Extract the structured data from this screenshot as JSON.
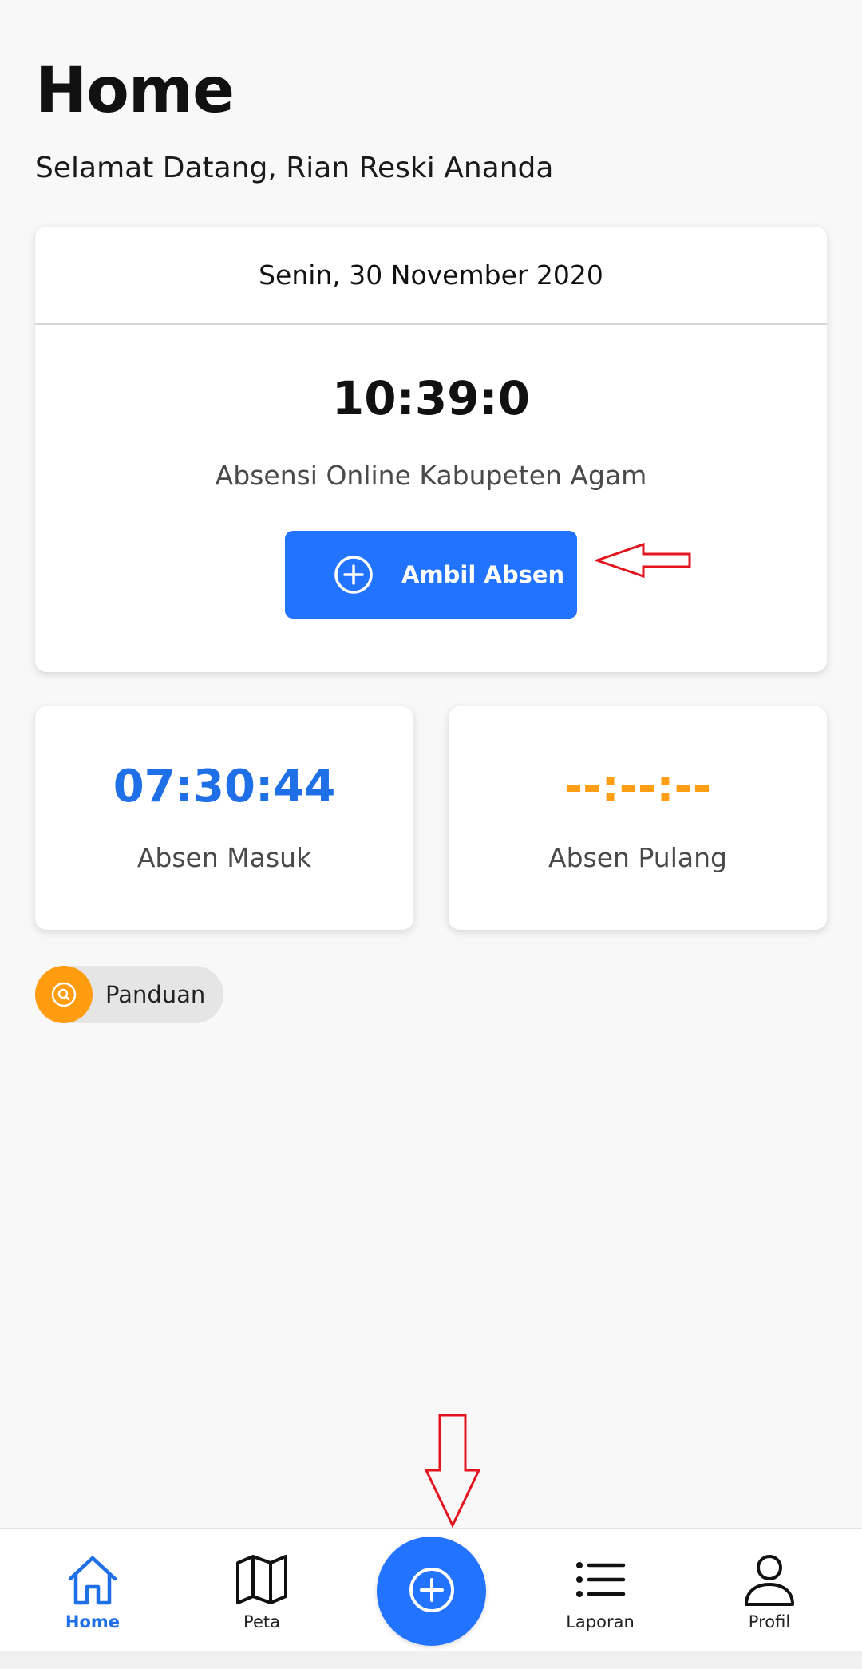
{
  "header": {
    "title": "Home",
    "welcome": "Selamat Datang, Rian Reski Ananda"
  },
  "main_card": {
    "date": "Senin, 30 November 2020",
    "clock": "10:39:0",
    "subtitle": "Absensi Online Kabupeten Agam",
    "button_label": "Ambil Absen",
    "button_icon": "plus-circle-icon"
  },
  "attendance": {
    "masuk": {
      "time": "07:30:44",
      "label": "Absen Masuk",
      "color": "#1f6fe6"
    },
    "pulang": {
      "time": "--:--:--",
      "label": "Absen Pulang",
      "color": "#ff9e12"
    }
  },
  "guide": {
    "label": "Panduan",
    "icon": "search-circle-icon",
    "color": "#ff9c0f"
  },
  "bottom_nav": {
    "items": [
      {
        "label": "Home",
        "icon": "home-icon",
        "active": true
      },
      {
        "label": "Peta",
        "icon": "map-icon",
        "active": false
      },
      {
        "label": "Laporan",
        "icon": "list-icon",
        "active": false
      },
      {
        "label": "Profil",
        "icon": "user-icon",
        "active": false
      }
    ],
    "fab_icon": "plus-circle-icon"
  },
  "colors": {
    "primary": "#2273ff",
    "accent": "#ff9c0f",
    "annotation": "#e3141e",
    "background": "#f8f8f8"
  }
}
